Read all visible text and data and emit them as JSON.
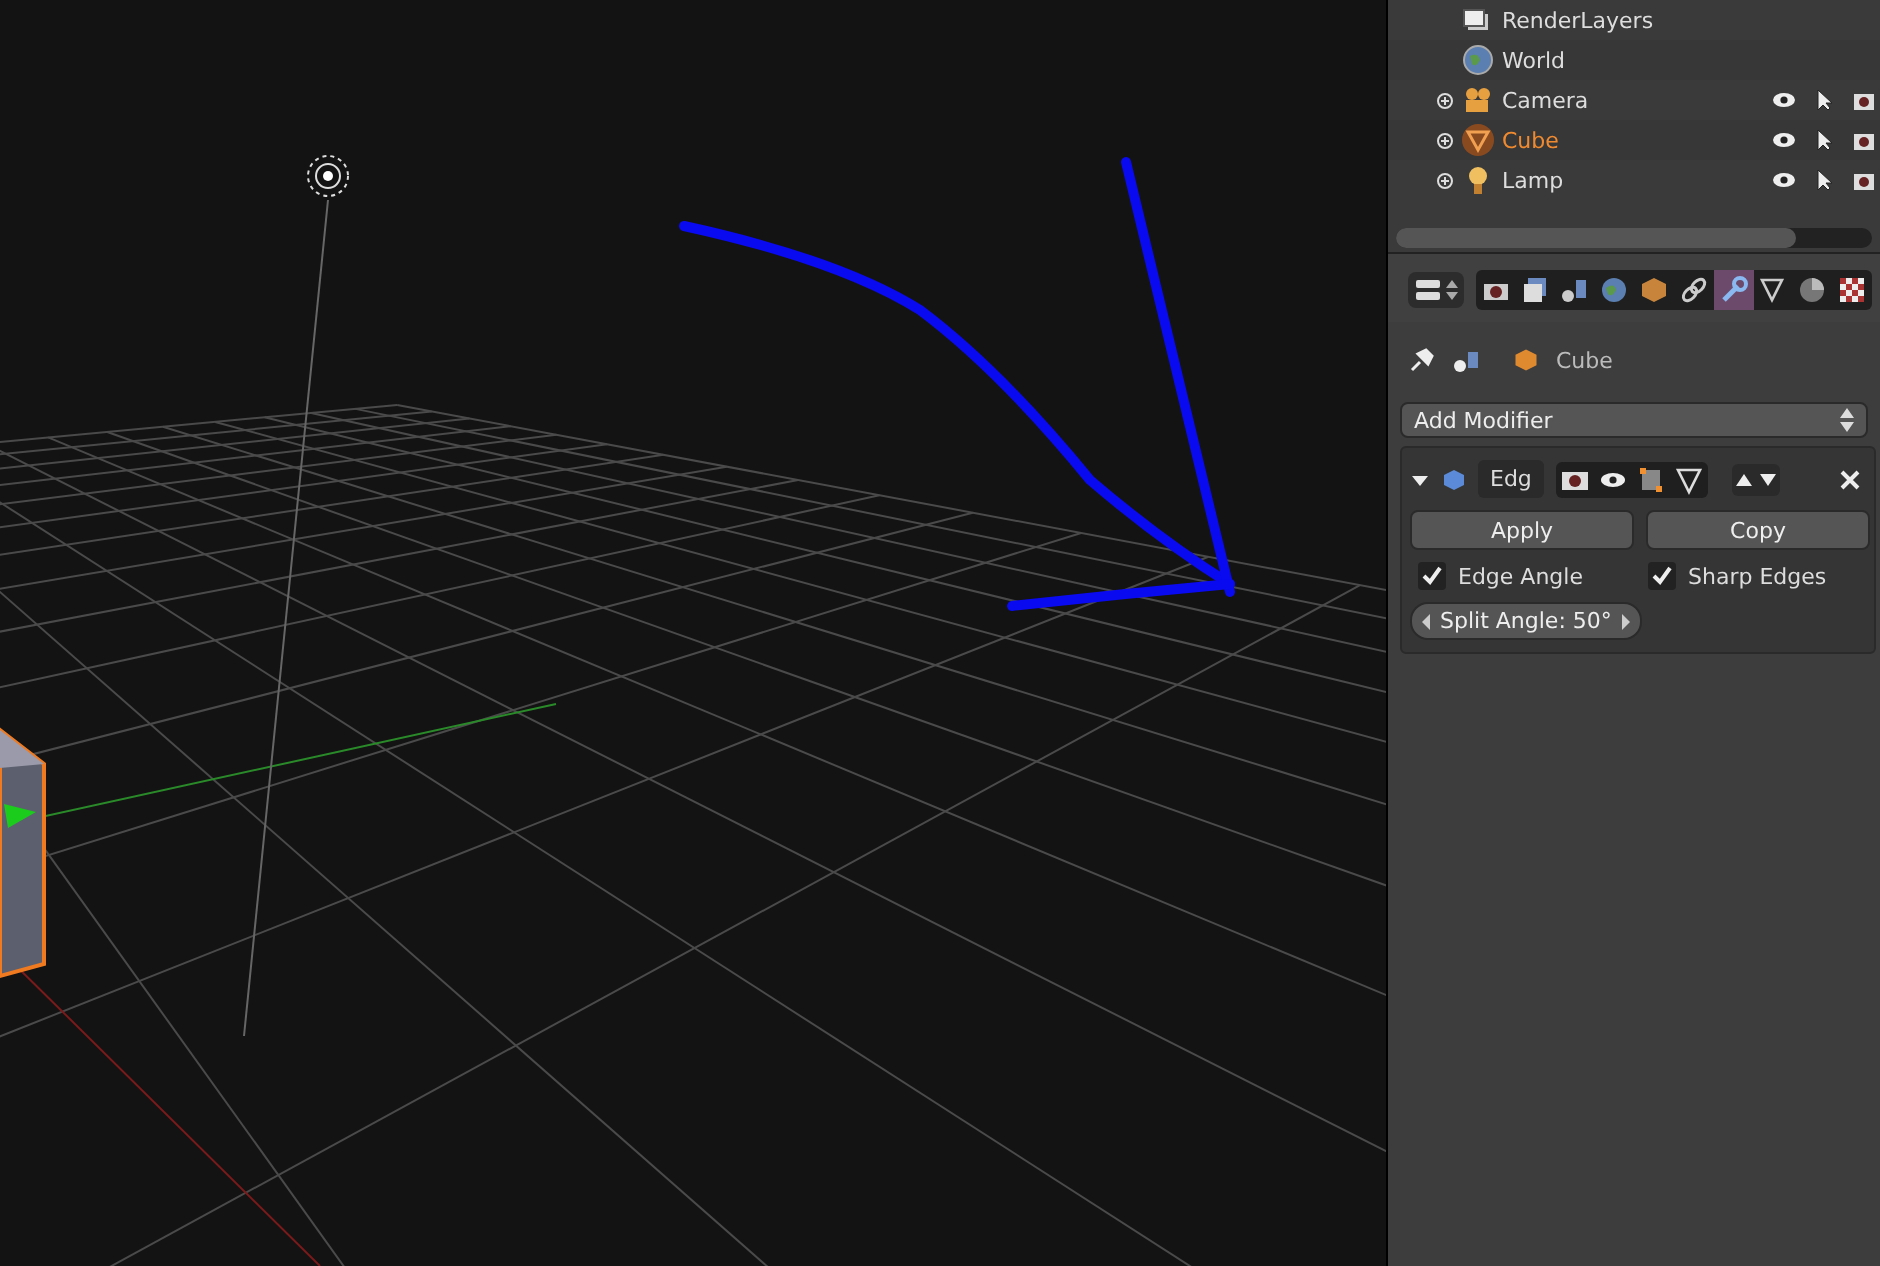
{
  "outliner": {
    "items": [
      {
        "name": "RenderLayers",
        "kind": "renderlayers",
        "expandable": false,
        "selected": false
      },
      {
        "name": "World",
        "kind": "world",
        "expandable": false,
        "selected": false
      },
      {
        "name": "Camera",
        "kind": "camera",
        "expandable": true,
        "selected": false
      },
      {
        "name": "Cube",
        "kind": "mesh",
        "expandable": true,
        "selected": true
      },
      {
        "name": "Lamp",
        "kind": "lamp",
        "expandable": true,
        "selected": false
      }
    ]
  },
  "properties": {
    "tabs": [
      {
        "kind": "render",
        "selected": false
      },
      {
        "kind": "layers",
        "selected": false
      },
      {
        "kind": "scene",
        "selected": false
      },
      {
        "kind": "world",
        "selected": false
      },
      {
        "kind": "object",
        "selected": false
      },
      {
        "kind": "constraints",
        "selected": false
      },
      {
        "kind": "modifiers",
        "selected": true
      },
      {
        "kind": "data",
        "selected": false
      },
      {
        "kind": "material",
        "selected": false
      },
      {
        "kind": "texture",
        "selected": false
      }
    ],
    "breadcrumb": "Cube",
    "add_modifier": "Add Modifier",
    "modifier": {
      "name": "Edg",
      "expanded": true,
      "buttons": [
        "Apply",
        "Copy"
      ],
      "options": [
        {
          "label": "Edge Angle",
          "checked": true
        },
        {
          "label": "Sharp Edges",
          "checked": true
        }
      ],
      "split_angle": "Split Angle: 50°"
    }
  }
}
